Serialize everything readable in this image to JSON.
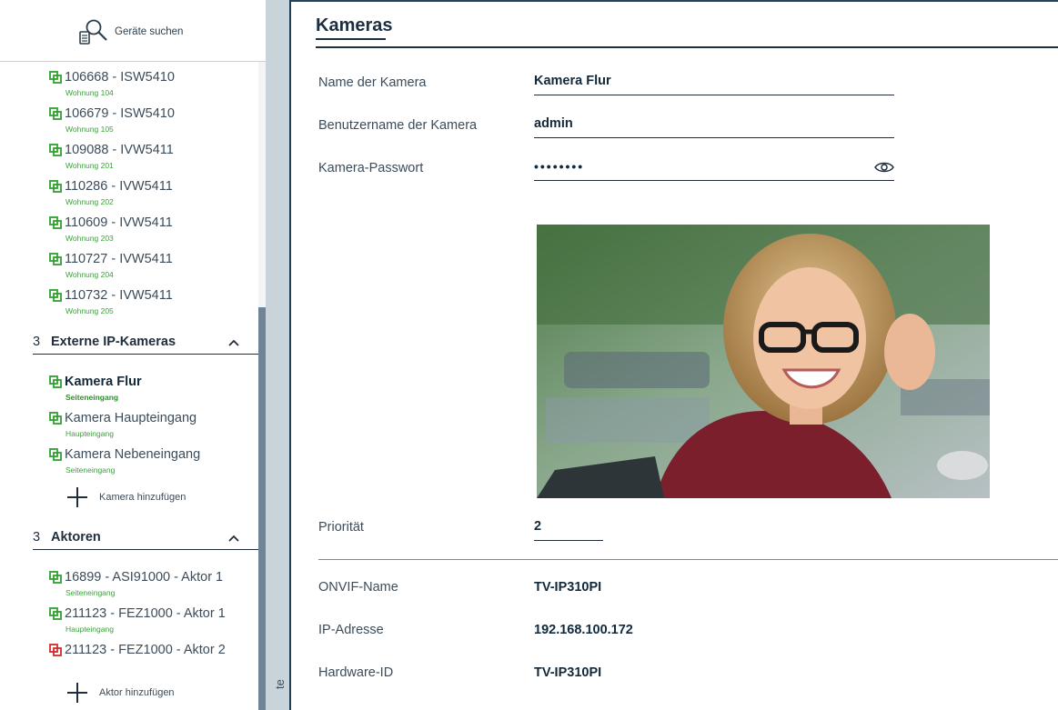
{
  "sidebar": {
    "search_label": "Geräte suchen",
    "devices_top": [
      {
        "name": "106668 - ISW5410",
        "sub": "Wohnung 104",
        "status": "green"
      },
      {
        "name": "106679 - ISW5410",
        "sub": "Wohnung 105",
        "status": "green"
      },
      {
        "name": "109088 - IVW5411",
        "sub": "Wohnung 201",
        "status": "green"
      },
      {
        "name": "110286 - IVW5411",
        "sub": "Wohnung 202",
        "status": "green"
      },
      {
        "name": "110609 - IVW5411",
        "sub": "Wohnung 203",
        "status": "green"
      },
      {
        "name": "110727 - IVW5411",
        "sub": "Wohnung 204",
        "status": "green"
      },
      {
        "name": "110732 - IVW5411",
        "sub": "Wohnung 205",
        "status": "green"
      }
    ],
    "cameras_section": {
      "count": "3",
      "title": "Externe IP-Kameras"
    },
    "cameras": [
      {
        "name": "Kamera Flur",
        "sub": "Seiteneingang",
        "status": "green",
        "active": true
      },
      {
        "name": "Kamera Haupteingang",
        "sub": "Haupteingang",
        "status": "green"
      },
      {
        "name": "Kamera Nebeneingang",
        "sub": "Seiteneingang",
        "status": "green"
      }
    ],
    "add_camera_label": "Kamera hinzufügen",
    "actors_section": {
      "count": "3",
      "title": "Aktoren"
    },
    "actors": [
      {
        "name": "16899 - ASI91000 - Aktor 1",
        "sub": "Seiteneingang",
        "status": "green"
      },
      {
        "name": "211123 - FEZ1000 - Aktor 1",
        "sub": "Haupteingang",
        "status": "green"
      },
      {
        "name": "211123 - FEZ1000 - Aktor 2",
        "sub": "",
        "status": "red"
      }
    ],
    "add_actor_label": "Aktor hinzufügen"
  },
  "strip": {
    "label": "te"
  },
  "main": {
    "title": "Kameras",
    "fields": {
      "name_label": "Name der Kamera",
      "name_value": "Kamera Flur",
      "user_label": "Benutzername der Kamera",
      "user_value": "admin",
      "password_label": "Kamera-Passwort",
      "password_value": "••••••••",
      "priority_label": "Priorität",
      "priority_value": "2"
    },
    "info": {
      "onvif_label": "ONVIF-Name",
      "onvif_value": "TV-IP310PI",
      "ip_label": "IP-Adresse",
      "ip_value": "192.168.100.172",
      "hw_label": "Hardware-ID",
      "hw_value": "TV-IP310PI"
    }
  },
  "colors": {
    "accent": "#1c2f40",
    "status_green": "#2fa02f",
    "status_red": "#d42a2a",
    "strip": "#c9d3da"
  },
  "icons": {
    "search": "search-device-icon",
    "device_status": "linked-device-icon",
    "chevron": "chevron-up-icon",
    "add": "plus-icon",
    "eye": "eye-icon"
  }
}
